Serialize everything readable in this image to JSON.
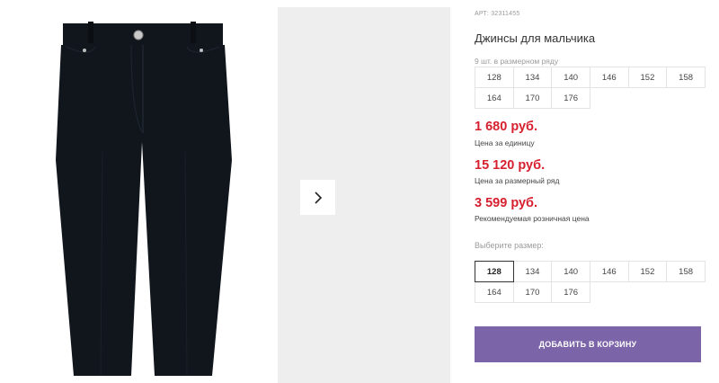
{
  "product": {
    "article": "АРТ: 32311455",
    "title": "Джинсы для мальчика",
    "pack_label": "9 шт. в размерном ряду",
    "pack_sizes": [
      "128",
      "134",
      "140",
      "146",
      "152",
      "158",
      "164",
      "170",
      "176"
    ]
  },
  "prices": [
    {
      "amount": "1 680 руб.",
      "caption": "Цена за единицу"
    },
    {
      "amount": "15 120 руб.",
      "caption": "Цена за размерный ряд"
    },
    {
      "amount": "3 599 руб.",
      "caption": "Рекомендуемая розничная цена"
    }
  ],
  "size_selector": {
    "label": "Выберите размер:",
    "selected": "128",
    "sizes": [
      "128",
      "134",
      "140",
      "146",
      "152",
      "158",
      "164",
      "170",
      "176"
    ]
  },
  "cart_button": {
    "label": "ДОБАВИТЬ В КОРЗИНУ"
  },
  "gallery": {
    "next_icon": "chevron-right-icon"
  },
  "colors": {
    "price": "#d7202f",
    "button": "#7c64a9",
    "denim": "#11161d"
  }
}
